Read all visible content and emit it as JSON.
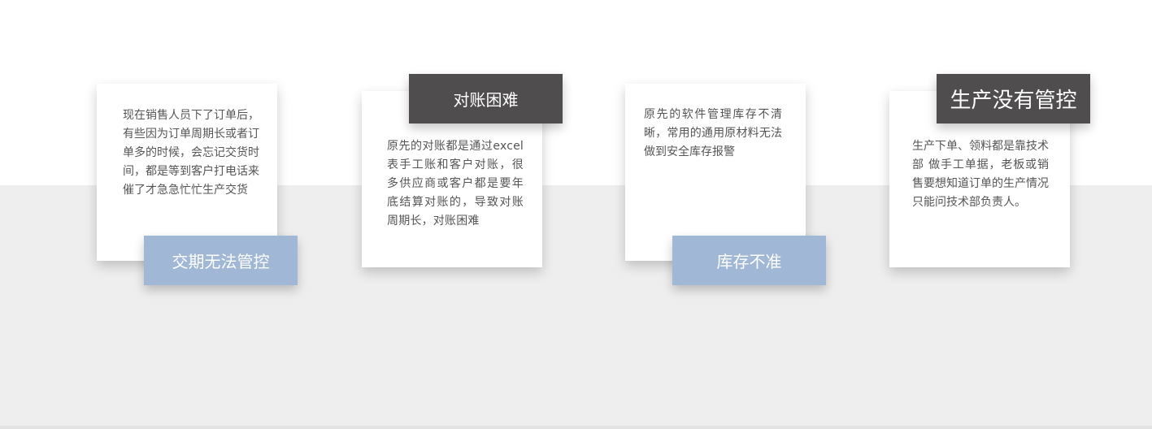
{
  "cards": [
    {
      "label": "交期无法管控",
      "text": "现在销售人员下了订单后，有些因为订单周期长或者订单多的时候，会忘记交货时间，都是等到客户打电话来催了才急急忙忙生产交货"
    },
    {
      "label": "对账困难",
      "text": "原先的对账都是通过excel表手工账和客户对账，很多供应商或客户都是要年底结算对账的，导致对账周期长，对账困难"
    },
    {
      "label": "库存不准",
      "text": "原先的软件管理库存不清晰，常用的通用原材料无法做到安全库存报警"
    },
    {
      "label": "生产没有管控",
      "text": "生产下单、领料都是靠技术部 做手工单据，老板或销售要想知道订单的生产情况只能问技术部负责人。"
    }
  ],
  "colors": {
    "dark_label": "#4f4d4e",
    "light_label": "#a0b8d5",
    "band_gray": "#eeeeee",
    "text": "#555555"
  }
}
